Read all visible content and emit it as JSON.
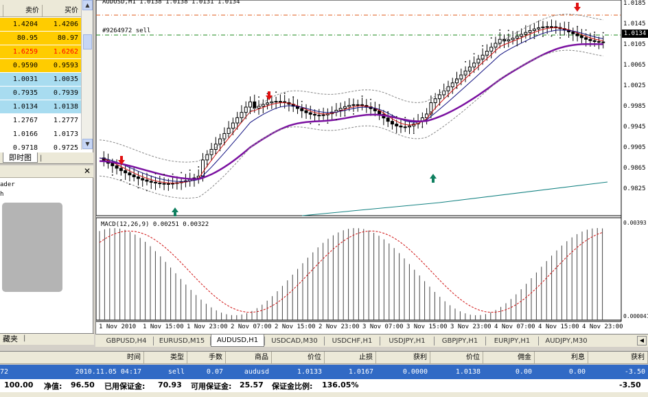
{
  "quotes": {
    "headers": [
      "卖价",
      "买价"
    ],
    "rows": [
      {
        "bid": "1.4204",
        "ask": "1.4206",
        "bg": "#ffcc00",
        "fg": "#000000"
      },
      {
        "bid": "80.95",
        "ask": "80.97",
        "bg": "#ffcc00",
        "fg": "#000000"
      },
      {
        "bid": "1.6259",
        "ask": "1.6262",
        "bg": "#ffcc00",
        "fg": "#ff0000"
      },
      {
        "bid": "0.9590",
        "ask": "0.9593",
        "bg": "#ffcc00",
        "fg": "#000000"
      },
      {
        "bid": "1.0031",
        "ask": "1.0035",
        "bg": "#a8dcf0",
        "fg": "#000000"
      },
      {
        "bid": "0.7935",
        "ask": "0.7939",
        "bg": "#a8dcf0",
        "fg": "#000000"
      },
      {
        "bid": "1.0134",
        "ask": "1.0138",
        "bg": "#a8dcf0",
        "fg": "#000000"
      },
      {
        "bid": "1.2767",
        "ask": "1.2777",
        "bg": "#ffffff",
        "fg": "#000000"
      },
      {
        "bid": "1.0166",
        "ask": "1.0173",
        "bg": "#ffffff",
        "fg": "#000000"
      },
      {
        "bid": "0.9718",
        "ask": "0.9725",
        "bg": "#ffffff",
        "fg": "#000000"
      }
    ],
    "tab_label": "即时图"
  },
  "navigator": {
    "lines": [
      "ader",
      "h",
      "",
      "",
      "",
      "",
      "",
      "",
      "",
      "",
      "",
      "",
      "",
      "",
      ""
    ]
  },
  "favorites_label": "藏夹",
  "chart": {
    "title": "AUDUSD,H1  1.0138 1.0138 1.0131 1.0134",
    "order_label": "#9264972 sell",
    "macd_label": "MACD(12,26,9) 0.00251 0.00322",
    "current_price": "1.0134",
    "price_ticks": [
      "1.0185",
      "1.0145",
      "1.0105",
      "1.0065",
      "1.0025",
      "0.9985",
      "0.9945",
      "0.9905",
      "0.9865",
      "0.9825"
    ],
    "macd_ticks": [
      "0.00393",
      "0.000041"
    ],
    "time_ticks": [
      "1 Nov 2010",
      "1 Nov 15:00",
      "1 Nov 23:00",
      "2 Nov 07:00",
      "2 Nov 15:00",
      "2 Nov 23:00",
      "3 Nov 07:00",
      "3 Nov 15:00",
      "3 Nov 23:00",
      "4 Nov 07:00",
      "4 Nov 15:00",
      "4 Nov 23:00"
    ]
  },
  "symbol_tabs": [
    "GBPUSD,H4",
    "EURUSD,M15",
    "AUDUSD,H1",
    "USDCAD,M30",
    "USDCHF,H1",
    "USDJPY,H1",
    "GBPJPY,H1",
    "EURJPY,H1",
    "AUDJPY,M30"
  ],
  "active_tab": "AUDUSD,H1",
  "terminal": {
    "headers": [
      "时间",
      "类型",
      "手数",
      "商品",
      "价位",
      "止损",
      "获利",
      "价位",
      "佣金",
      "利息",
      "获利"
    ],
    "row": [
      "72",
      "2010.11.05 04:17",
      "sell",
      "0.07",
      "audusd",
      "1.0133",
      "1.0167",
      "0.0000",
      "1.0138",
      "0.00",
      "0.00",
      "-3.50"
    ],
    "status": {
      "balance": "100.00",
      "equity_label": "净值:",
      "equity": "96.50",
      "margin_label": "已用保证金:",
      "margin": "70.93",
      "free_label": "可用保证金:",
      "free": "25.57",
      "level_label": "保证金比例:",
      "level": "136.05%",
      "profit": "-3.50"
    }
  }
}
